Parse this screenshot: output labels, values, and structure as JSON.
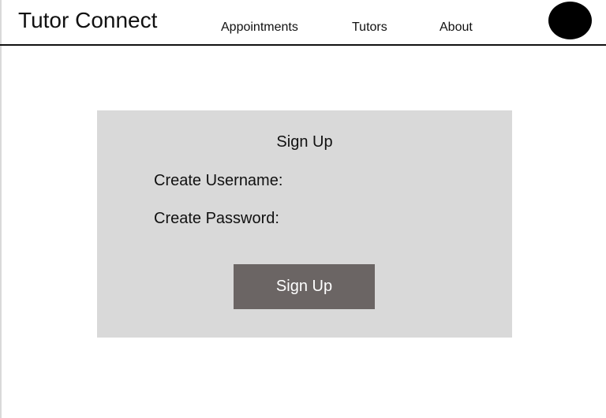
{
  "header": {
    "app_title": "Tutor Connect",
    "nav": [
      {
        "label": "Appointments"
      },
      {
        "label": "Tutors"
      },
      {
        "label": "About"
      }
    ]
  },
  "signup": {
    "title": "Sign Up",
    "username_label": "Create Username:",
    "password_label": "Create Password:",
    "button_label": "Sign Up"
  },
  "colors": {
    "panel_background": "#d9d9d9",
    "button_background": "#6b6564",
    "button_text": "#ffffff",
    "avatar": "#000000"
  }
}
